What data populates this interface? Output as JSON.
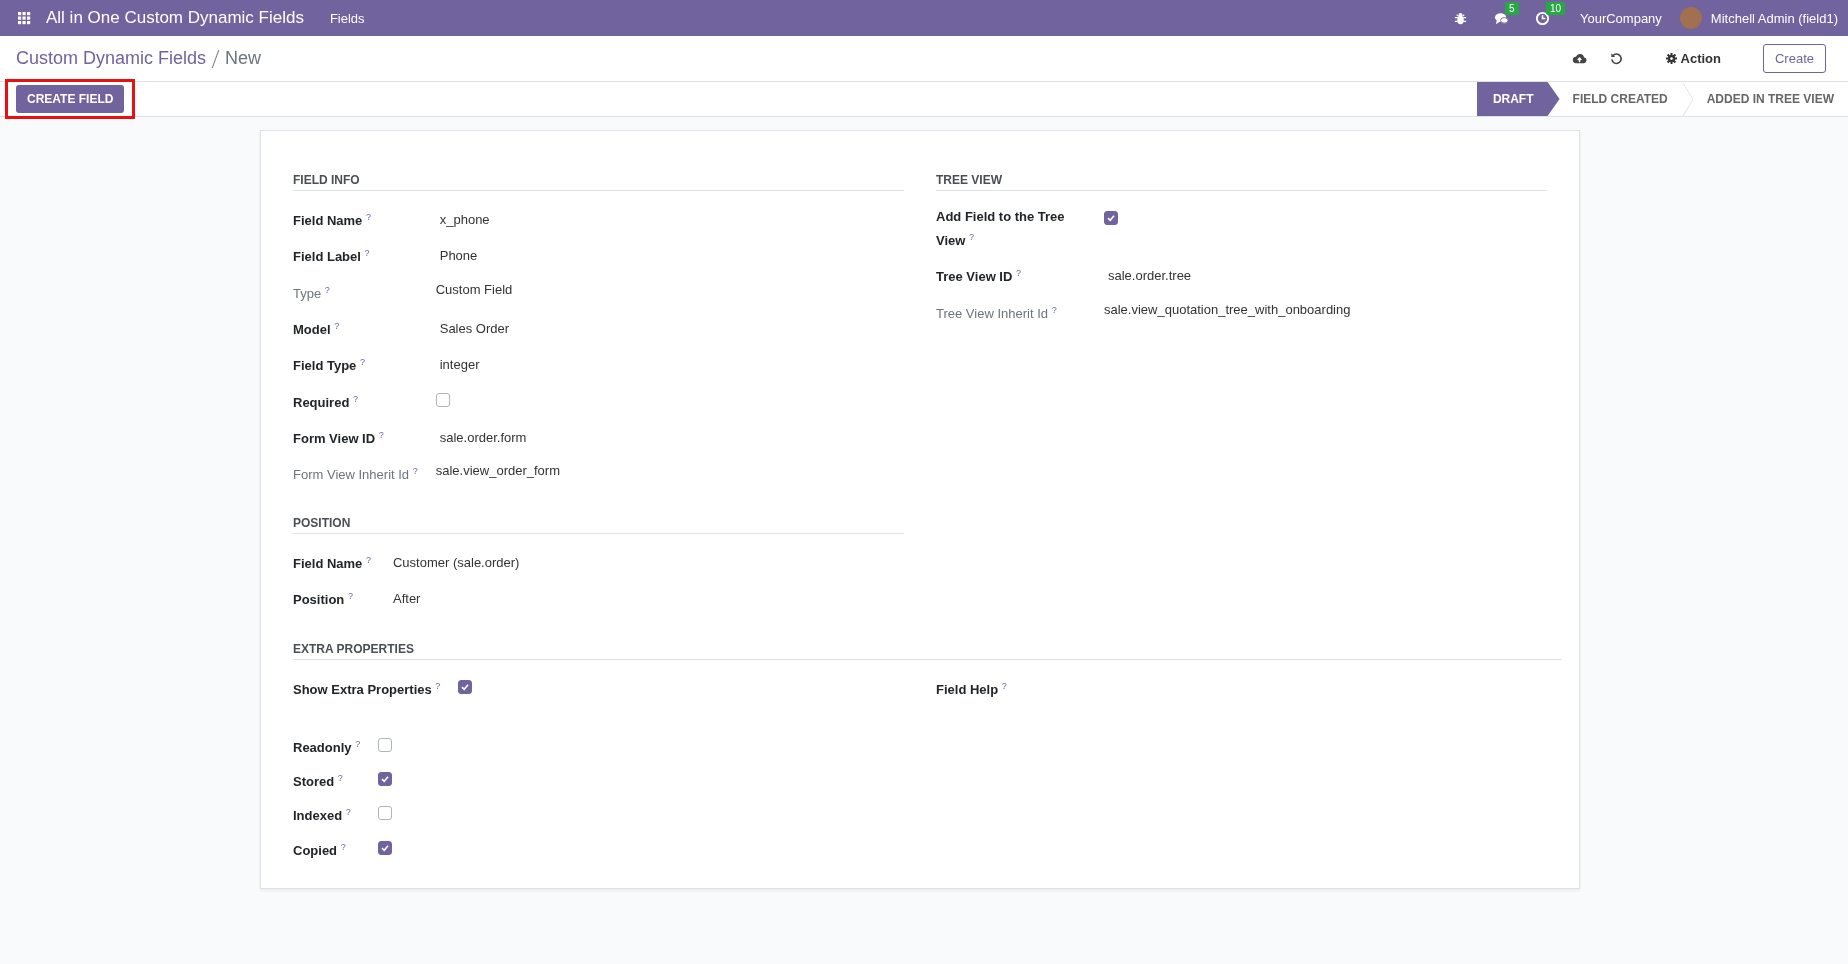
{
  "navbar": {
    "app_title": "All in One Custom Dynamic Fields",
    "menus": [
      "Fields"
    ],
    "systray": [
      {
        "kind": "bug"
      },
      {
        "kind": "chat",
        "badge": "5"
      },
      {
        "kind": "activity",
        "badge": "10"
      }
    ],
    "company": "YourCompany",
    "user": "Mitchell Admin (field1)"
  },
  "control_panel": {
    "breadcrumbs": [
      "Custom Dynamic Fields",
      "New"
    ],
    "action_label": "Action",
    "create_label": "Create"
  },
  "statusbar": {
    "button": {
      "label": "CREATE FIELD",
      "highlighted": true
    },
    "statuses": [
      {
        "label": "DRAFT",
        "selected": true
      },
      {
        "label": "FIELD CREATED",
        "selected": false
      },
      {
        "label": "ADDED IN TREE VIEW",
        "selected": false
      }
    ]
  },
  "sheet": {
    "columns": [
      [
        {
          "title": "FIELD INFO",
          "fields": [
            {
              "label": "Field Name $^{?}$",
              "readonly": false,
              "kind": "text",
              "value": "x_phone"
            },
            {
              "label": "Field Label $^{?}$",
              "readonly": false,
              "kind": "text",
              "value": "Phone"
            },
            {
              "label": "Type $^{?}$",
              "readonly": true,
              "kind": "text",
              "value": "Custom Field"
            },
            {
              "label": "Model $^{?}$",
              "readonly": false,
              "kind": "text",
              "value": "Sales Order"
            },
            {
              "label": "Field Type $^{?}$",
              "readonly": false,
              "kind": "text",
              "value": "integer"
            },
            {
              "label": "Required $^{?}$",
              "readonly": false,
              "kind": "checkbox",
              "checked": false
            },
            {
              "label": "Form View ID $^{?}$",
              "readonly": false,
              "kind": "text",
              "value": "sale.order.form"
            },
            {
              "label": "Form View Inherit Id $^{?}$",
              "readonly": true,
              "kind": "text",
              "value": "sale.view_order_form"
            }
          ]
        },
        {
          "title": "POSITION",
          "fields": [
            {
              "label": "Field Name $^{?}$",
              "readonly": false,
              "kind": "text",
              "value": "Customer (sale.order)"
            },
            {
              "label": "Position $^{?}$",
              "readonly": false,
              "kind": "text",
              "value": "After"
            }
          ]
        }
      ],
      [
        {
          "title": "TREE VIEW",
          "fields": [
            {
              "label": "Add Field to the Tree View $^{?}$",
              "readonly": false,
              "kind": "checkbox",
              "checked": true
            },
            {
              "label": "Tree View ID $^{?}$",
              "readonly": false,
              "kind": "text",
              "value": "sale.order.tree"
            },
            {
              "label": "Tree View Inherit Id $^{?}$",
              "readonly": true,
              "kind": "text",
              "value": "sale.view_quotation_tree_with_onboarding"
            }
          ]
        }
      ]
    ],
    "extra": {
      "title": "EXTRA PROPERTIES",
      "columns": [
        [
          {
            "label": "Show Extra Properties $^{?}$",
            "readonly": false,
            "kind": "checkbox",
            "checked": true
          }
        ],
        [
          {
            "label": "Field Help $^{?}$",
            "readonly": false,
            "kind": "empty"
          }
        ]
      ],
      "fields": [
        {
          "label": "Readonly $^{?}$",
          "readonly": false,
          "kind": "checkbox",
          "checked": false
        },
        {
          "label": "Stored $^{?}$",
          "readonly": false,
          "kind": "checkbox",
          "checked": true
        },
        {
          "label": "Indexed $^{?}$",
          "readonly": false,
          "kind": "checkbox",
          "checked": false
        },
        {
          "label": "Copied $^{?}$",
          "readonly": false,
          "kind": "checkbox",
          "checked": true
        }
      ]
    }
  }
}
